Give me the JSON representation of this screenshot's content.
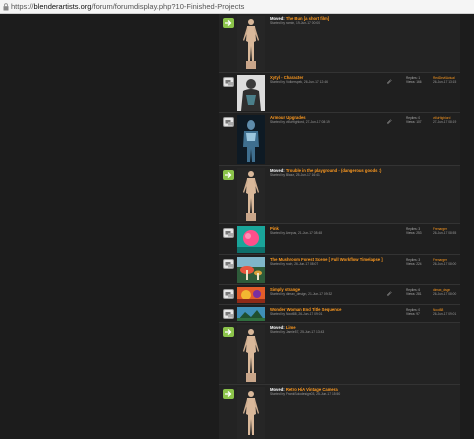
{
  "address_bar": {
    "url_prefix": "https://",
    "url_domain": "blenderartists.org",
    "url_path": "/forum/forumdisplay.php?10-Finished-Projects"
  },
  "threads": [
    {
      "moved": true,
      "moved_label": "Moved:",
      "title": "The Bun [a short film]",
      "starter": "Started by ramin, 19-Jun-17 00:00",
      "replies": "",
      "views": "",
      "last_user": "",
      "last_date": "",
      "thumb": "figure"
    },
    {
      "moved": false,
      "moved_label": "",
      "title": "Xytyl - Character",
      "starter": "Started by Volkerspek, 26-Jun-17 12:46",
      "replies": "Replies: 1",
      "views": "Views: 166",
      "last_user": "RedDevilActual",
      "last_date": "26-Jun-17 13:15",
      "thumb": "character"
    },
    {
      "moved": false,
      "moved_label": "",
      "title": "Armour Upgrades",
      "starter": "Started by villuHighlord, 27-Jun-17 08:19",
      "replies": "Replies: 0",
      "views": "Views: 107",
      "last_user": "villuHighlord",
      "last_date": "27-Jun-17 08:19",
      "thumb": "armour"
    },
    {
      "moved": true,
      "moved_label": "Moved:",
      "title": "Trouble in the playground - (dangerous goods :)",
      "starter": "Started by Blazz, 25-Jun-17 16:41",
      "replies": "",
      "views": "",
      "last_user": "",
      "last_date": "",
      "thumb": "figure"
    },
    {
      "moved": false,
      "moved_label": "",
      "title": "Pink",
      "starter": "Started by Arepus, 21-Jun-17 08:48",
      "replies": "Replies: 3",
      "views": "Views: 253",
      "last_user": "Frenarger",
      "last_date": "26-Jun-17 08:55",
      "thumb": "pink"
    },
    {
      "moved": false,
      "moved_label": "",
      "title": "The Mushroom Forest Scene [ Full Workflow Timelapse ]",
      "starter": "Started by roch, 26-Jun-17 08:07",
      "replies": "Replies: 3",
      "views": "Views: 224",
      "last_user": "Frenarger",
      "last_date": "26-Jun-17 08:00",
      "thumb": "mushroom"
    },
    {
      "moved": false,
      "moved_label": "",
      "title": "Simply strange",
      "starter": "Started by dimax_design, 21-Jun-17 09:32",
      "replies": "Replies: 6",
      "views": "Views: 281",
      "last_user": "dimax_dsgn",
      "last_date": "26-Jun-17 08:00",
      "thumb": "strange"
    },
    {
      "moved": false,
      "moved_label": "",
      "title": "Wonder Woman End Title Sequence",
      "starter": "Started by Noot88, 26-Jun-17 09:01",
      "replies": "Replies: 0",
      "views": "Views: 97",
      "last_user": "Noot88",
      "last_date": "26-Jun-17 09:01",
      "thumb": "wonder"
    },
    {
      "moved": true,
      "moved_label": "Moved:",
      "title": "Lime",
      "starter": "Started by Jamie57, 25-Jun-17 13:43",
      "replies": "",
      "views": "",
      "last_user": "",
      "last_date": "",
      "thumb": "figure"
    },
    {
      "moved": true,
      "moved_label": "Moved:",
      "title": "Retro HiA Vintage Camera",
      "starter": "Started by FrankSolodesign03, 25-Jun-17 15:50",
      "replies": "",
      "views": "",
      "last_user": "",
      "last_date": "",
      "thumb": "figure"
    }
  ],
  "colors": {
    "moved_status": "#8bc34a",
    "title": "#ff9a1f",
    "background": "#1f1f1f"
  }
}
